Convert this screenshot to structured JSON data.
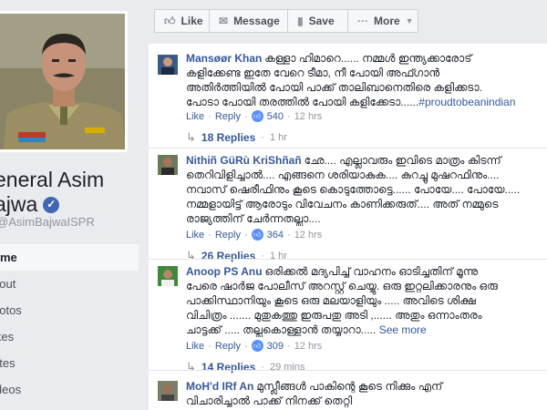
{
  "page": {
    "name_line1": "eneral Asim",
    "name_line2": "ajwa",
    "handle": "AsimBajwaISPR",
    "nav": [
      "ome",
      "bout",
      "hotos",
      "ikes",
      "otes",
      "ideos"
    ]
  },
  "action_bar": {
    "like": "Like",
    "message": "Message",
    "save": "Save",
    "more": "More"
  },
  "comments": [
    {
      "author": "Mansøør Khan",
      "lines": [
        "കള്ളാ ഹിമാറെ...... നമ്മൾ ഇന്ത്യക്കാരോട്",
        "കളിക്കേണ്ട ഇതേ വേറെ ടീമാ, നീ പോയി അഫ്ഗാൻ",
        "അതിർത്തിയിൽ പോയി പാക്ക് താലിബാനെതിരെ കളിക്കടാ.",
        "പോടാ പോയി തരത്തിൽ പോയി കളിക്കേടാ......"
      ],
      "hashtag": "#proudtobeanindian",
      "like": "Like",
      "reply": "Reply",
      "reactions": "540",
      "time": "12 hrs",
      "replies_label": "18 Replies",
      "replies_time": "1 hr"
    },
    {
      "author": "Nithiñ GüRù KriShñañ",
      "lines": [
        "ഛേ.... എല്ലാവരും ഇവിടെ മാത്രം കിടന്ന്",
        "തെറിവിളിച്ചാൽ.... എങ്ങനെ ശരിയാകുക.... കുറച്ചു മുഷറഫിനും....",
        "നവാസ് ഷെരീഫിനും കൂടെ കൊടുത്തോട്ടെ...... പോയേ.... പോയേ.....",
        "നമ്മളായിട്ട് ആരോടും വിവേചനം കാണിക്കരുത്.... അത് നമ്മുടെ",
        "രാജ്യത്തിന് ചേർന്നതല്ലാ...."
      ],
      "hashtag": "",
      "like": "Like",
      "reply": "Reply",
      "reactions": "364",
      "time": "12 hrs",
      "replies_label": "26 Replies",
      "replies_time": "1 hr"
    },
    {
      "author": "Anoop PS Anu",
      "lines": [
        "ഒരിക്കൽ മദ്യപിച്ച് വാഹനം ഓടിച്ചതിന് മൂന്നു",
        "പേരെ ഷാർജ പോലീസ് അറസ്റ്റ് ചെയ്യു. ഒരു ഇറ്റലിക്കാരനും ഒരു",
        "പാക്കിസ്ഥാനിയും കൂടെ ഒരു മലയാളിയും ..... അവിടെ ശിക്ഷ",
        "വിചിത്രം ....... മുതുകത്തു ഇരുപതു അടി ,...... അതും ഒന്നാംതരം",
        "ചാട്ടക്ക് ..... തല്ലുകൊള്ളാൻ തയ്യാറാ....."
      ],
      "hashtag": "",
      "see_more": "See more",
      "like": "Like",
      "reply": "Reply",
      "reactions": "309",
      "time": "12 hrs",
      "replies_label": "14 Replies",
      "replies_time": "29 mins"
    },
    {
      "author": "MoH'd IRf An",
      "lines": [
        "മുസ്ലീങ്ങൾ പാകിന്റെ കൂടെ നിക്കും എന്",
        "വിചാരിച്ചാൽ പാക്ക് നിനക്ക് തെറ്റി"
      ]
    }
  ],
  "colors": {
    "link": "#365899",
    "muted": "#90949c",
    "like_badge": "#5890ff",
    "verified": "#4267b2"
  },
  "icons": {
    "like": "thumbs-up-icon",
    "message": "message-icon",
    "save": "bookmark-icon",
    "more": "ellipsis-icon"
  }
}
